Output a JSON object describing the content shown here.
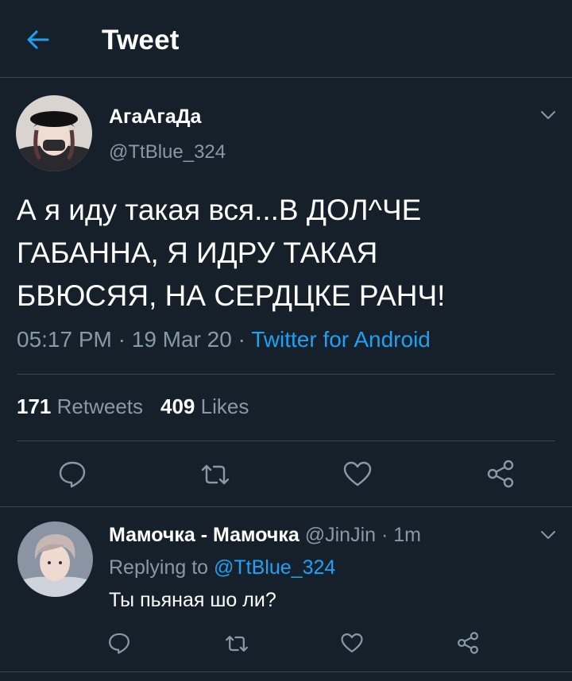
{
  "header": {
    "title": "Tweet",
    "back_icon": "arrow-left-icon"
  },
  "accent_color": "#1da1f2",
  "tweet": {
    "author_name": "АгаАгаДа",
    "author_handle": "@TtBlue_324",
    "text": "А я иду такая вся...В ДОЛ^ЧЕ\nГАБАННА, Я ИДРУ ТАКАЯ\nБВЮСЯЯ, НА СЕРДЦКЕ РАНЧ!",
    "time": "05:17 PM",
    "date": "19 Mar 20",
    "separator": "·",
    "source": "Twitter for Android",
    "retweets_count": "171",
    "retweets_label": "Retweets",
    "likes_count": "409",
    "likes_label": "Likes"
  },
  "reply": {
    "author_name": "Мамочка - Мамочка",
    "author_handle": "@JinJin",
    "time": "1m",
    "replying_label": "Replying to",
    "replying_to": "@TtBlue_324",
    "text": "Ты пьяная шо ли?"
  }
}
